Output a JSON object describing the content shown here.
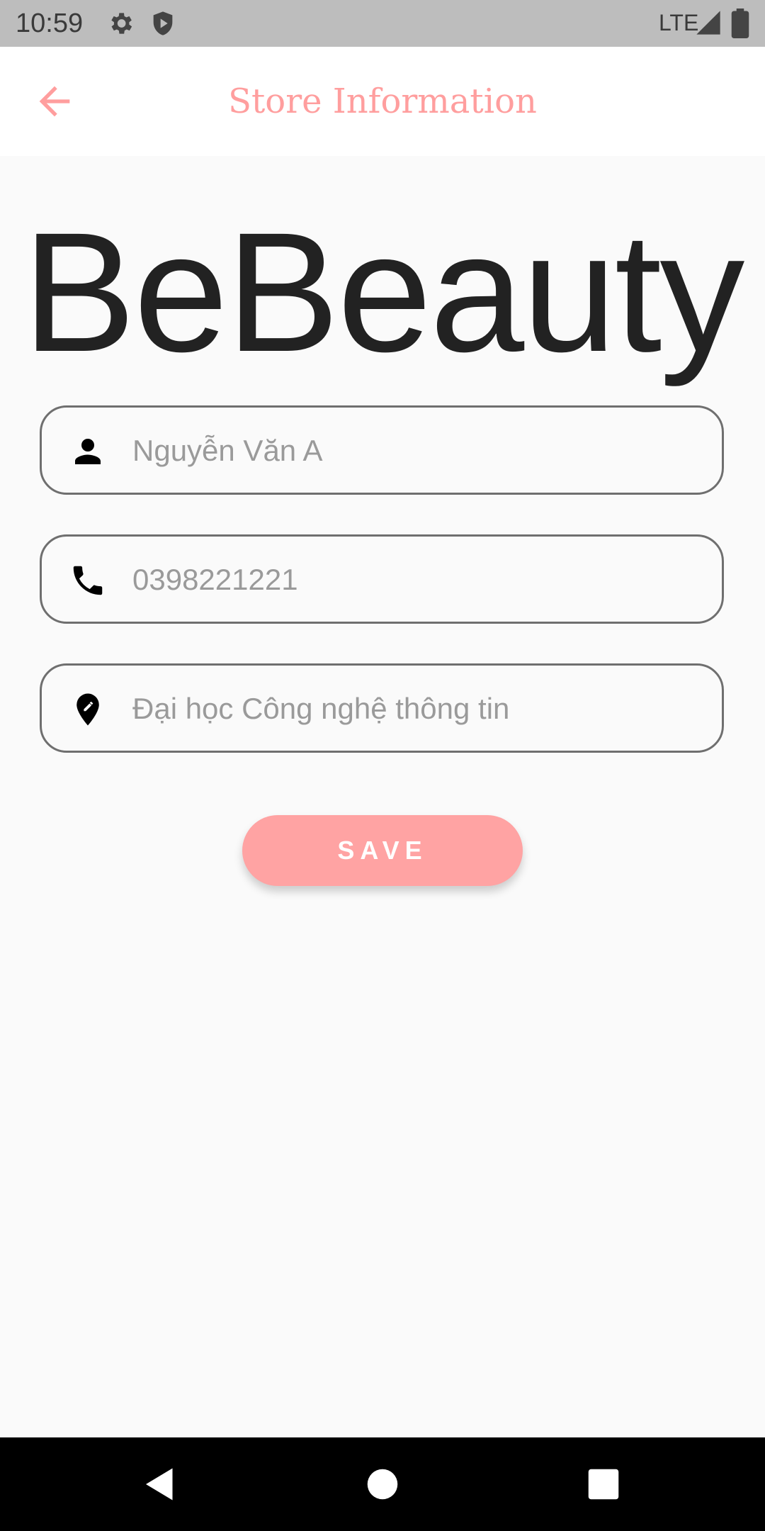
{
  "status_bar": {
    "time": "10:59",
    "network": "LTE"
  },
  "app_bar": {
    "title": "Store Information",
    "back_icon": "arrow-left-icon"
  },
  "logo": {
    "text": "BeBeauty"
  },
  "form": {
    "name": {
      "placeholder": "Nguyễn Văn A",
      "icon": "person-icon"
    },
    "phone": {
      "placeholder": "0398221221",
      "icon": "phone-icon"
    },
    "address": {
      "placeholder": "Đại học Công nghệ thông tin",
      "icon": "edit-location-icon"
    }
  },
  "save_button": {
    "label": "SAVE"
  },
  "colors": {
    "accent": "#ffa3a3",
    "title": "#ff9e9e",
    "background": "#fafafa"
  }
}
